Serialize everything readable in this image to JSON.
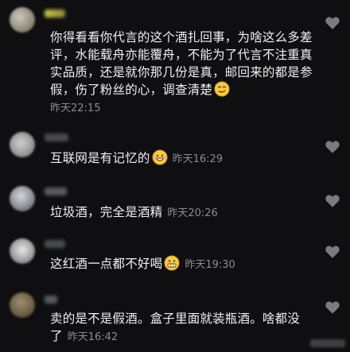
{
  "comments": [
    {
      "text": "你得看看你代言的这个酒扎回事，为啥这么多差评，水能载舟亦能覆舟，不能为了代言不注重真实品质，还是就你那几份是真，邮回来的都是参假，伤了粉丝的心，调查清楚",
      "emoji": "smirk-emoji",
      "time": "昨天22:15"
    },
    {
      "text": "互联网是有记忆的",
      "emoji": "grin-emoji",
      "time": "昨天16:29"
    },
    {
      "text": "垃圾酒，完全是酒精",
      "emoji": "",
      "time": "昨天20:26"
    },
    {
      "text": "这红酒一点都不好喝",
      "emoji": "grimace-emoji",
      "time": "昨天19:30"
    },
    {
      "text_line1": "卖的是不是假酒。盒子里面就装瓶酒。啥都没",
      "text_line2": "了",
      "emoji": "",
      "time": "昨天16:42"
    }
  ],
  "colors": {
    "background": "#0f0f12",
    "text": "#f2f2f2",
    "time": "#8b8b92",
    "heart": "#7a7a80"
  }
}
